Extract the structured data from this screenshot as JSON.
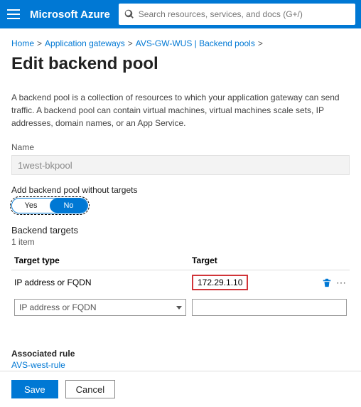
{
  "header": {
    "brand": "Microsoft Azure",
    "search_placeholder": "Search resources, services, and docs (G+/)"
  },
  "breadcrumb": {
    "items": [
      "Home",
      "Application gateways",
      "AVS-GW-WUS | Backend pools"
    ]
  },
  "page": {
    "title": "Edit backend pool",
    "description": "A backend pool is a collection of resources to which your application gateway can send traffic. A backend pool can contain virtual machines, virtual machines scale sets, IP addresses, domain names, or an App Service."
  },
  "form": {
    "name_label": "Name",
    "name_value": "1west-bkpool",
    "without_targets_label": "Add backend pool without targets",
    "toggle": {
      "yes": "Yes",
      "no": "No",
      "value": "No"
    }
  },
  "targets": {
    "heading": "Backend targets",
    "count": "1 item",
    "columns": {
      "type": "Target type",
      "target": "Target"
    },
    "rows": [
      {
        "type": "IP address or FQDN",
        "target": "172.29.1.10"
      }
    ],
    "new_row": {
      "type_placeholder": "IP address or FQDN",
      "target_value": ""
    }
  },
  "associated": {
    "label": "Associated rule",
    "link": "AVS-west-rule"
  },
  "footer": {
    "save": "Save",
    "cancel": "Cancel"
  }
}
